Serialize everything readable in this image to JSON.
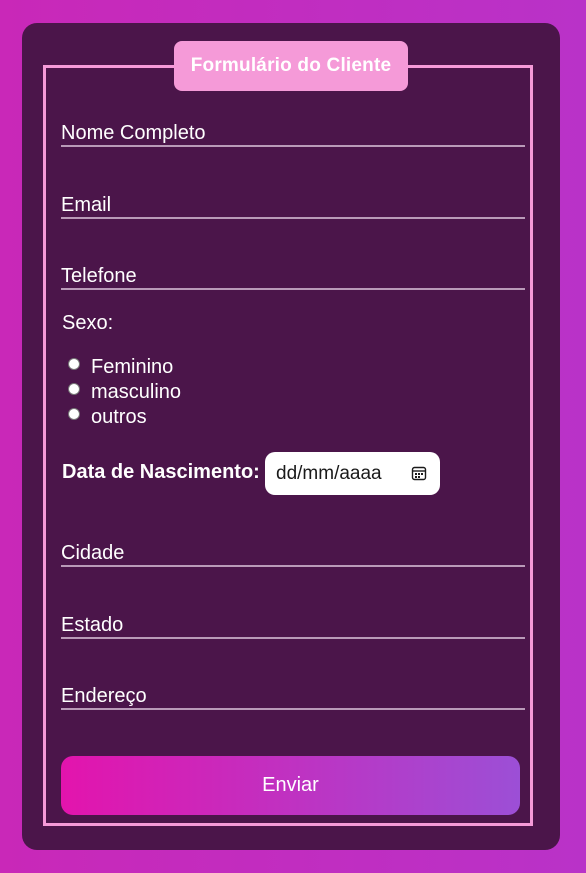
{
  "form": {
    "title": "Formulário do Cliente",
    "fields": {
      "nome": "Nome Completo",
      "email": "Email",
      "telefone": "Telefone",
      "cidade": "Cidade",
      "estado": "Estado",
      "endereco": "Endereço"
    },
    "sexo": {
      "label": "Sexo:",
      "options": [
        "Feminino",
        "masculino",
        "outros"
      ]
    },
    "nascimento": {
      "label": "Data de Nascimento:",
      "placeholder": "dd/mm/aaaa"
    },
    "submit_label": "Enviar"
  },
  "colors": {
    "background": "#c928b8",
    "card": "#4b154a",
    "accent": "#f59ad8",
    "button_start": "#e314ad",
    "button_end": "#9c4fd6"
  }
}
